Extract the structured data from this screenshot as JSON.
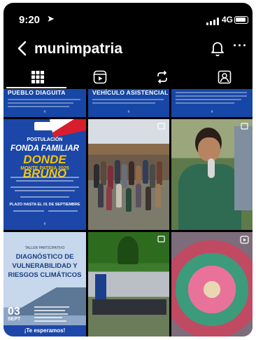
{
  "status_bar": {
    "time": "9:20",
    "network": "4G"
  },
  "header": {
    "username": "munimpatria",
    "more": "···"
  },
  "tabs": [
    {
      "name": "grid"
    },
    {
      "name": "reels"
    },
    {
      "name": "reposts"
    },
    {
      "name": "tagged"
    }
  ],
  "posts": {
    "row1": [
      {
        "title": "PUEBLO DIAGUITA"
      },
      {
        "title": "VEHÍCULO ASISTENCIAL"
      },
      {
        "title": ""
      }
    ],
    "fonda": {
      "label": "POSTULACIÓN",
      "title_line1": "FONDA FAMILIAR",
      "title_line2": "DONDE BRUNO",
      "subtitle": "MONTE PATRIA 2025",
      "deadline": "PLAZO HASTA EL 01 DE SEPTIEMBRE"
    },
    "riesgos": {
      "header": "TALLER PARTICIPATIVO",
      "line1": "DIAGNÓSTICO DE",
      "line2": "VULNERABILIDAD Y",
      "line3": "RIESGOS CLIMÁTICOS",
      "day": "03",
      "month": "SEPT",
      "cta": "¡Te esperamos!"
    }
  },
  "colors": {
    "background": "#000000",
    "brand_blue": "#1c47a8",
    "accent_yellow": "#f5c400"
  }
}
